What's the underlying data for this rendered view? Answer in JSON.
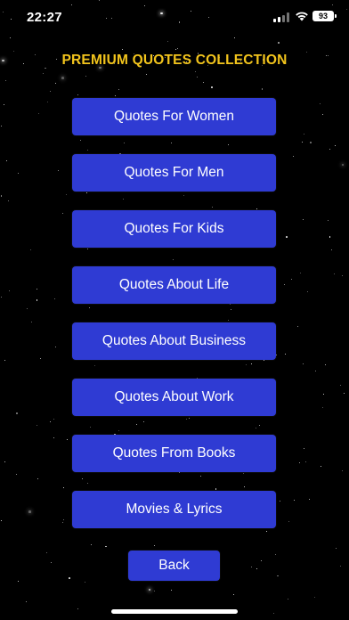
{
  "status_bar": {
    "time": "22:27",
    "battery": "93"
  },
  "title": "PREMIUM QUOTES COLLECTION",
  "menu": [
    "Quotes For Women",
    "Quotes For Men",
    "Quotes For Kids",
    "Quotes About Life",
    "Quotes About Business",
    "Quotes About Work",
    "Quotes From Books",
    "Movies & Lyrics"
  ],
  "back_label": "Back",
  "colors": {
    "background": "#000000",
    "title": "#f2c41c",
    "button": "#2f3bd3",
    "button_text": "#ffffff"
  }
}
